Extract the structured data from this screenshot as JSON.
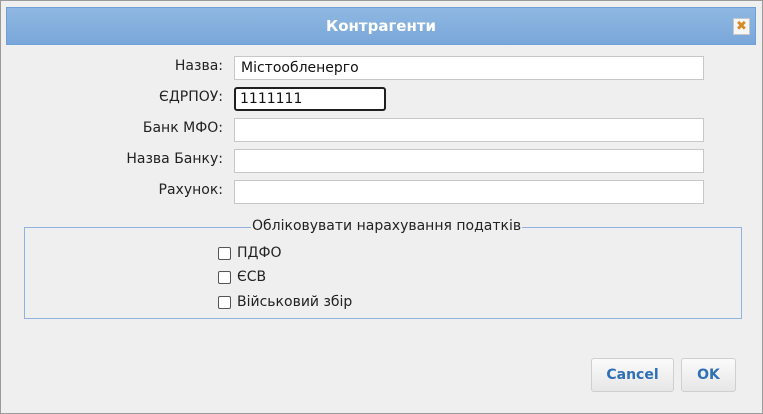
{
  "dialog": {
    "title": "Контрагенти",
    "close_icon": "close-icon"
  },
  "form": {
    "name_label": "Назва:",
    "name_value": "Містообленерго",
    "edrpou_label": "ЄДРПОУ:",
    "edrpou_value": "1111111",
    "mfo_label": "Банк МФО:",
    "mfo_value": "",
    "bank_name_label": "Назва Банку:",
    "bank_name_value": "",
    "account_label": "Рахунок:",
    "account_value": ""
  },
  "taxes": {
    "legend": "Обліковувати нарахування податків",
    "items": [
      {
        "label": "ПДФО",
        "checked": false
      },
      {
        "label": "ЄСВ",
        "checked": false
      },
      {
        "label": "Військовий збір",
        "checked": false
      }
    ]
  },
  "buttons": {
    "cancel_label": "Cancel",
    "ok_label": "OK"
  },
  "colors": {
    "titlebar": "#79a7d9",
    "button_text": "#2f6fb6"
  }
}
